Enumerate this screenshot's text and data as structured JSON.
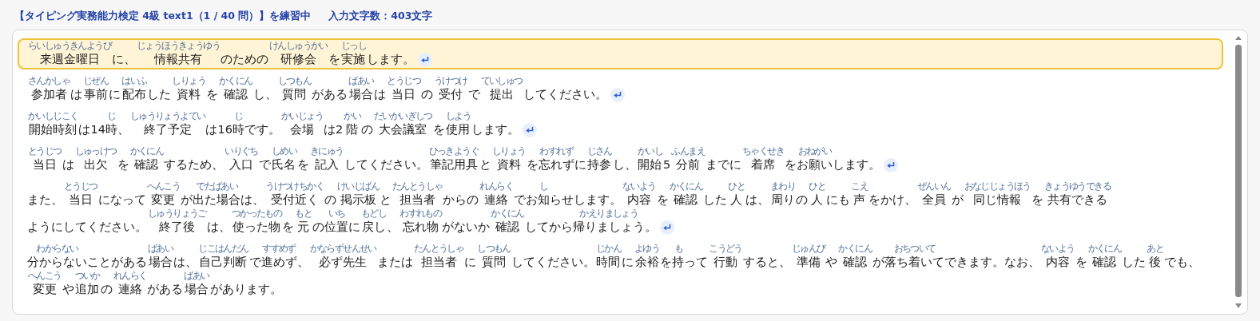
{
  "header": {
    "title": "【タイピング実務能力検定 4級 text1（1 / 40 問）】を練習中",
    "char_count": "入力文字数：403文字"
  },
  "paragraphs": [
    {
      "selected": true,
      "line_break": true,
      "segments": [
        {
          "ruby": "らいしゅうきんようび",
          "text": "来週金曜日"
        },
        {
          "text": "に、"
        },
        {
          "ruby": "じょうほうきょうゆう",
          "text": "情報共有"
        },
        {
          "text": "のための"
        },
        {
          "ruby": "けんしゅうかい",
          "text": "研修会"
        },
        {
          "text": "を"
        },
        {
          "ruby": "じっし",
          "text": "実施"
        },
        {
          "text": "します。"
        }
      ]
    },
    {
      "selected": false,
      "line_break": true,
      "segments": [
        {
          "ruby": "さんかしゃ",
          "text": "参加者"
        },
        {
          "text": "は"
        },
        {
          "ruby": "じぜん",
          "text": "事前"
        },
        {
          "text": "に"
        },
        {
          "ruby": "はいふ",
          "text": "配布"
        },
        {
          "text": "した"
        },
        {
          "ruby": "しりょう",
          "text": "資料"
        },
        {
          "text": "を"
        },
        {
          "ruby": "かくにん",
          "text": "確認"
        },
        {
          "text": "し、"
        },
        {
          "ruby": "しつもん",
          "text": "質問"
        },
        {
          "text": "がある"
        },
        {
          "ruby": "ばあい",
          "text": "場合"
        },
        {
          "text": "は"
        },
        {
          "ruby": "とうじつ",
          "text": "当日"
        },
        {
          "text": "の"
        },
        {
          "ruby": "うけつけ",
          "text": "受付"
        },
        {
          "text": "で"
        },
        {
          "ruby": "ていしゅつ",
          "text": "提出"
        },
        {
          "text": "してください。"
        }
      ]
    },
    {
      "selected": false,
      "line_break": true,
      "segments": [
        {
          "ruby": "かいしじこく",
          "text": "開始時刻"
        },
        {
          "text": "は14"
        },
        {
          "ruby": "じ",
          "text": "時"
        },
        {
          "text": "、"
        },
        {
          "ruby": "しゅうりょうよてい",
          "text": "終了予定"
        },
        {
          "text": "は16"
        },
        {
          "ruby": "じ",
          "text": "時"
        },
        {
          "text": "です。"
        },
        {
          "ruby": "かいじょう",
          "text": "会場"
        },
        {
          "text": "は2"
        },
        {
          "ruby": "かい",
          "text": "階"
        },
        {
          "text": "の"
        },
        {
          "ruby": "だいかいぎしつ",
          "text": "大会議室"
        },
        {
          "text": "を"
        },
        {
          "ruby": "しよう",
          "text": "使用"
        },
        {
          "text": "します。"
        }
      ]
    },
    {
      "selected": false,
      "line_break": true,
      "segments": [
        {
          "ruby": "とうじつ",
          "text": "当日"
        },
        {
          "text": "は"
        },
        {
          "ruby": "しゅっけつ",
          "text": "出欠"
        },
        {
          "text": "を"
        },
        {
          "ruby": "かくにん",
          "text": "確認"
        },
        {
          "text": "するため、"
        },
        {
          "ruby": "いりぐち",
          "text": "入口"
        },
        {
          "text": "で"
        },
        {
          "ruby": "しめい",
          "text": "氏名"
        },
        {
          "text": "を"
        },
        {
          "ruby": "きにゅう",
          "text": "記入"
        },
        {
          "text": "してください。"
        },
        {
          "ruby": "ひっきようぐ",
          "text": "筆記用具"
        },
        {
          "text": "と"
        },
        {
          "ruby": "しりょう",
          "text": "資料"
        },
        {
          "text": "を"
        },
        {
          "ruby": "わすれず",
          "text": "忘れず"
        },
        {
          "text": "に"
        },
        {
          "ruby": "じさん",
          "text": "持参"
        },
        {
          "text": "し、"
        },
        {
          "ruby": "かいし",
          "text": "開始"
        },
        {
          "text": "5"
        },
        {
          "ruby": "ふんまえ",
          "text": "分前"
        },
        {
          "text": "までに"
        },
        {
          "ruby": "ちゃくせき",
          "text": "着席"
        },
        {
          "text": "を"
        },
        {
          "ruby": "おねがい",
          "text": "お願い"
        },
        {
          "text": "します。"
        }
      ]
    },
    {
      "selected": false,
      "line_break": true,
      "segments": [
        {
          "text": "また、"
        },
        {
          "ruby": "とうじつ",
          "text": "当日"
        },
        {
          "text": "になって"
        },
        {
          "ruby": "へんこう",
          "text": "変更"
        },
        {
          "text": "が"
        },
        {
          "ruby": "でたばあい",
          "text": "出た場合"
        },
        {
          "text": "は、"
        },
        {
          "ruby": "うけつけちかく",
          "text": "受付近く"
        },
        {
          "text": "の"
        },
        {
          "ruby": "けいじばん",
          "text": "掲示板"
        },
        {
          "text": "と"
        },
        {
          "ruby": "たんとうしゃ",
          "text": "担当者"
        },
        {
          "text": "からの"
        },
        {
          "ruby": "れんらく",
          "text": "連絡"
        },
        {
          "text": "でお"
        },
        {
          "ruby": "し",
          "text": "知"
        },
        {
          "text": "らせします。"
        },
        {
          "ruby": "ないよう",
          "text": "内容"
        },
        {
          "text": "を"
        },
        {
          "ruby": "かくにん",
          "text": "確認"
        },
        {
          "text": "した"
        },
        {
          "ruby": "ひと",
          "text": "人"
        },
        {
          "text": "は、"
        },
        {
          "ruby": "まわり",
          "text": "周り"
        },
        {
          "text": "の"
        },
        {
          "ruby": "ひと",
          "text": "人"
        },
        {
          "text": "にも"
        },
        {
          "ruby": "こえ",
          "text": "声"
        },
        {
          "text": "をかけ、"
        },
        {
          "ruby": "ぜんいん",
          "text": "全員"
        },
        {
          "text": "が"
        },
        {
          "ruby": "おなじじょうほう",
          "text": "同じ情報"
        },
        {
          "text": "を"
        },
        {
          "ruby": "きょうゆうできる",
          "text": "共有できる"
        },
        {
          "text": "ようにしてください。"
        },
        {
          "ruby": "しゅうりょうご",
          "text": "終了後"
        },
        {
          "text": "は、"
        },
        {
          "ruby": "つかったもの",
          "text": "使った物"
        },
        {
          "text": "を"
        },
        {
          "ruby": "もと",
          "text": "元"
        },
        {
          "text": "の"
        },
        {
          "ruby": "いち",
          "text": "位置"
        },
        {
          "text": "に"
        },
        {
          "ruby": "もどし",
          "text": "戻し"
        },
        {
          "text": "、"
        },
        {
          "ruby": "わすれもの",
          "text": "忘れ物"
        },
        {
          "text": "がないか"
        },
        {
          "ruby": "かくにん",
          "text": "確認"
        },
        {
          "text": "してから"
        },
        {
          "ruby": "かえりましょう",
          "text": "帰りましょう"
        },
        {
          "text": "。"
        }
      ]
    },
    {
      "selected": false,
      "line_break": false,
      "segments": [
        {
          "ruby": "わからない",
          "text": "分からない"
        },
        {
          "text": "ことがある"
        },
        {
          "ruby": "ばあい",
          "text": "場合"
        },
        {
          "text": "は、"
        },
        {
          "ruby": "じこはんだん",
          "text": "自己判断"
        },
        {
          "text": "で"
        },
        {
          "ruby": "すすめず",
          "text": "進めず"
        },
        {
          "text": "、"
        },
        {
          "ruby": "かならずせんせい",
          "text": "必ず先生"
        },
        {
          "text": "または"
        },
        {
          "ruby": "たんとうしゃ",
          "text": "担当者"
        },
        {
          "text": "に"
        },
        {
          "ruby": "しつもん",
          "text": "質問"
        },
        {
          "text": "してください。"
        },
        {
          "ruby": "じかん",
          "text": "時間"
        },
        {
          "text": "に"
        },
        {
          "ruby": "よゆう",
          "text": "余裕"
        },
        {
          "text": "を"
        },
        {
          "ruby": "も",
          "text": "持"
        },
        {
          "text": "って"
        },
        {
          "ruby": "こうどう",
          "text": "行動"
        },
        {
          "text": "すると、"
        },
        {
          "ruby": "じゅんび",
          "text": "準備"
        },
        {
          "text": "や"
        },
        {
          "ruby": "かくにん",
          "text": "確認"
        },
        {
          "text": "が"
        },
        {
          "ruby": "おちついて",
          "text": "落ち着いて"
        },
        {
          "text": "できます。なお、"
        },
        {
          "ruby": "ないよう",
          "text": "内容"
        },
        {
          "text": "を"
        },
        {
          "ruby": "かくにん",
          "text": "確認"
        },
        {
          "text": "した"
        },
        {
          "ruby": "あと",
          "text": "後"
        },
        {
          "text": "でも、"
        },
        {
          "ruby": "へんこう",
          "text": "変更"
        },
        {
          "text": "や"
        },
        {
          "ruby": "ついか",
          "text": "追加"
        },
        {
          "text": "の"
        },
        {
          "ruby": "れんらく",
          "text": "連絡"
        },
        {
          "text": "がある"
        },
        {
          "ruby": "ばあい",
          "text": "場合"
        },
        {
          "text": "があります。"
        }
      ]
    }
  ]
}
